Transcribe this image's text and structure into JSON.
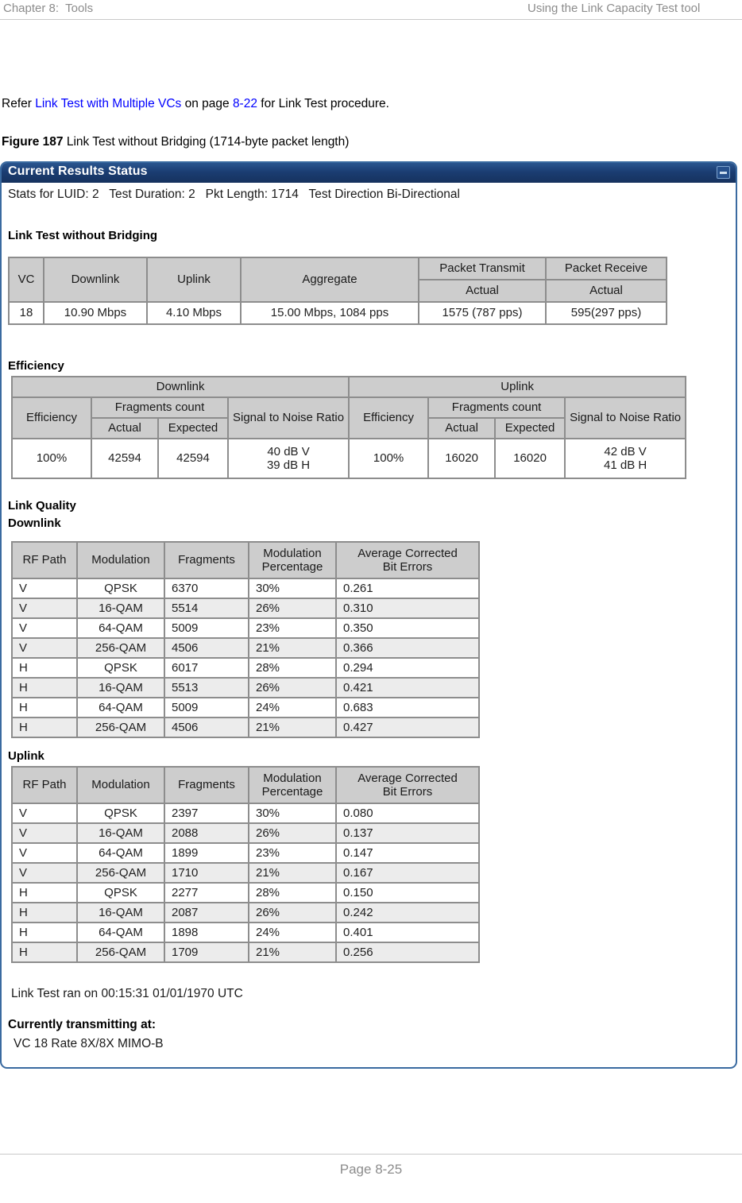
{
  "running_head": {
    "left": "Chapter 8:  Tools",
    "right": "Using the Link Capacity Test tool"
  },
  "refer_paragraph": {
    "prefix": "Refer ",
    "link_text": "Link Test with Multiple VCs",
    "middle": " on page ",
    "page_ref": "8-22",
    "suffix": " for Link Test procedure."
  },
  "figure_caption": {
    "number": "Figure 187",
    "text": " Link Test without Bridging (1714-byte packet length)"
  },
  "panel": {
    "title": "Current Results Status",
    "minimize_icon": "minimize-icon",
    "stats_line": "Stats for LUID: 2   Test Duration: 2   Pkt Length: 1714   Test Direction Bi-Directional",
    "link_test_heading": "Link Test without Bridging",
    "efficiency_heading": "Efficiency",
    "link_quality_heading": "Link Quality",
    "downlink_heading": "Downlink",
    "uplink_heading": "Uplink",
    "ran_on": "Link Test ran on 00:15:31 01/01/1970 UTC",
    "transmitting_heading": "Currently transmitting at:",
    "transmitting_value": "VC 18 Rate 8X/8X MIMO-B"
  },
  "link_test_table": {
    "headers": {
      "vc": "VC",
      "downlink": "Downlink",
      "uplink": "Uplink",
      "aggregate": "Aggregate",
      "packet_transmit": "Packet Transmit",
      "packet_receive": "Packet Receive",
      "transmit_sub": "Actual",
      "receive_sub": "Actual"
    },
    "row": {
      "vc": "18",
      "downlink": "10.90 Mbps",
      "uplink": "4.10 Mbps",
      "aggregate": "15.00 Mbps,  1084 pps",
      "packet_transmit": "1575 (787 pps)",
      "packet_receive": "595(297 pps)"
    }
  },
  "efficiency_table": {
    "headers": {
      "downlink_group": "Downlink",
      "uplink_group": "Uplink",
      "efficiency": "Efficiency",
      "fragments_count": "Fragments count",
      "signal_to_noise": "Signal to Noise Ratio",
      "actual": "Actual",
      "expected": "Expected"
    },
    "downlink": {
      "efficiency": "100%",
      "fragments_actual": "42594",
      "fragments_expected": "42594",
      "snr_v": "40 dB V",
      "snr_h": "39 dB H"
    },
    "uplink": {
      "efficiency": "100%",
      "fragments_actual": "16020",
      "fragments_expected": "16020",
      "snr_v": "42 dB V",
      "snr_h": "41 dB H"
    }
  },
  "link_quality": {
    "columns": [
      "RF Path",
      "Modulation",
      "Fragments",
      "Modulation Percentage",
      "Average Corrected Bit Errors"
    ],
    "columns_split": [
      {
        "l1": "RF Path",
        "l2": ""
      },
      {
        "l1": "Modulation",
        "l2": ""
      },
      {
        "l1": "Fragments",
        "l2": ""
      },
      {
        "l1": "Modulation",
        "l2": "Percentage"
      },
      {
        "l1": "Average Corrected",
        "l2": "Bit Errors"
      }
    ],
    "downlink_rows": [
      {
        "rf_path": "V",
        "modulation": "QPSK",
        "fragments": "6370",
        "mod_pct": "30%",
        "avg_errors": "0.261"
      },
      {
        "rf_path": "V",
        "modulation": "16-QAM",
        "fragments": "5514",
        "mod_pct": "26%",
        "avg_errors": "0.310"
      },
      {
        "rf_path": "V",
        "modulation": "64-QAM",
        "fragments": "5009",
        "mod_pct": "23%",
        "avg_errors": "0.350"
      },
      {
        "rf_path": "V",
        "modulation": "256-QAM",
        "fragments": "4506",
        "mod_pct": "21%",
        "avg_errors": "0.366"
      },
      {
        "rf_path": "H",
        "modulation": "QPSK",
        "fragments": "6017",
        "mod_pct": "28%",
        "avg_errors": "0.294"
      },
      {
        "rf_path": "H",
        "modulation": "16-QAM",
        "fragments": "5513",
        "mod_pct": "26%",
        "avg_errors": "0.421"
      },
      {
        "rf_path": "H",
        "modulation": "64-QAM",
        "fragments": "5009",
        "mod_pct": "24%",
        "avg_errors": "0.683"
      },
      {
        "rf_path": "H",
        "modulation": "256-QAM",
        "fragments": "4506",
        "mod_pct": "21%",
        "avg_errors": "0.427"
      }
    ],
    "uplink_rows": [
      {
        "rf_path": "V",
        "modulation": "QPSK",
        "fragments": "2397",
        "mod_pct": "30%",
        "avg_errors": "0.080"
      },
      {
        "rf_path": "V",
        "modulation": "16-QAM",
        "fragments": "2088",
        "mod_pct": "26%",
        "avg_errors": "0.137"
      },
      {
        "rf_path": "V",
        "modulation": "64-QAM",
        "fragments": "1899",
        "mod_pct": "23%",
        "avg_errors": "0.147"
      },
      {
        "rf_path": "V",
        "modulation": "256-QAM",
        "fragments": "1710",
        "mod_pct": "21%",
        "avg_errors": "0.167"
      },
      {
        "rf_path": "H",
        "modulation": "QPSK",
        "fragments": "2277",
        "mod_pct": "28%",
        "avg_errors": "0.150"
      },
      {
        "rf_path": "H",
        "modulation": "16-QAM",
        "fragments": "2087",
        "mod_pct": "26%",
        "avg_errors": "0.242"
      },
      {
        "rf_path": "H",
        "modulation": "64-QAM",
        "fragments": "1898",
        "mod_pct": "24%",
        "avg_errors": "0.401"
      },
      {
        "rf_path": "H",
        "modulation": "256-QAM",
        "fragments": "1709",
        "mod_pct": "21%",
        "avg_errors": "0.256"
      }
    ]
  },
  "footer": {
    "page_label": "Page 8-25"
  },
  "colors": {
    "link": "#0000ff",
    "titlebar": "#1b3d72",
    "panel_border": "#3a6aa0",
    "table_header_bg": "#cdcdcd",
    "table_alt_row_bg": "#ececec",
    "running_head": "#8c8c8c"
  }
}
